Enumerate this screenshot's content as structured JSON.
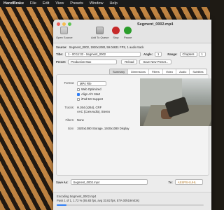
{
  "menubar": {
    "app": "HandBrake",
    "items": [
      "File",
      "Edit",
      "View",
      "Presets",
      "Window",
      "Help"
    ]
  },
  "window": {
    "title": "Segment_0002.mp4",
    "toolbar": {
      "open_source": "Open Source",
      "add_to_queue": "Add To Queue",
      "start": "Stop",
      "pause": "Pause"
    },
    "source": {
      "label": "Source:",
      "value": "Segment_0002, 1920x1080, 59.04631 FPS, 1 audio track"
    },
    "title_row": {
      "label": "Title:",
      "value": "1 - 00:11:33 - Segment_0002",
      "angle_label": "Angle:",
      "angle_value": "1",
      "range_label": "Range:",
      "range_value": "Chapters",
      "range_start": "1"
    },
    "preset": {
      "label": "Preset:",
      "value": "Production Max",
      "reload": "Reload",
      "save": "Save New Preset..."
    },
    "tabs": [
      "Summary",
      "Dimensions",
      "Filters",
      "Video",
      "Audio",
      "Subtitles"
    ],
    "active_tab": "Summary",
    "summary": {
      "format_label": "Format:",
      "format_value": "MP4 File",
      "options": [
        {
          "label": "Web Optimized",
          "checked": false
        },
        {
          "label": "Align A/V Start",
          "checked": true
        },
        {
          "label": "iPod 5G Support",
          "checked": false
        }
      ],
      "tracks_label": "Tracks:",
      "tracks_video": "H.264 (x264), CRF",
      "tracks_audio": "AAC (CoreAudio), Stereo",
      "filters_label": "Filters:",
      "filters_value": "None",
      "size_label": "Size:",
      "size_value": "1920x1080 Storage, 1920x1080 Display"
    },
    "save_as": {
      "label": "Save As:",
      "value": "Segment_0002.mp4",
      "to_label": "To:",
      "to_value": "ASSPSH.UHL"
    },
    "status": {
      "line1": "Encoding Segment_0002.mp4",
      "line2": "Pass 1 of 1, 1.72 % (55.83 fps, avg 33.82 fps, ETA 00h19m03s)",
      "progress": 0.0172
    },
    "colors": {
      "accent": "#2f7ef6",
      "stop": "#c62929",
      "pause": "#2a9d2a"
    }
  }
}
